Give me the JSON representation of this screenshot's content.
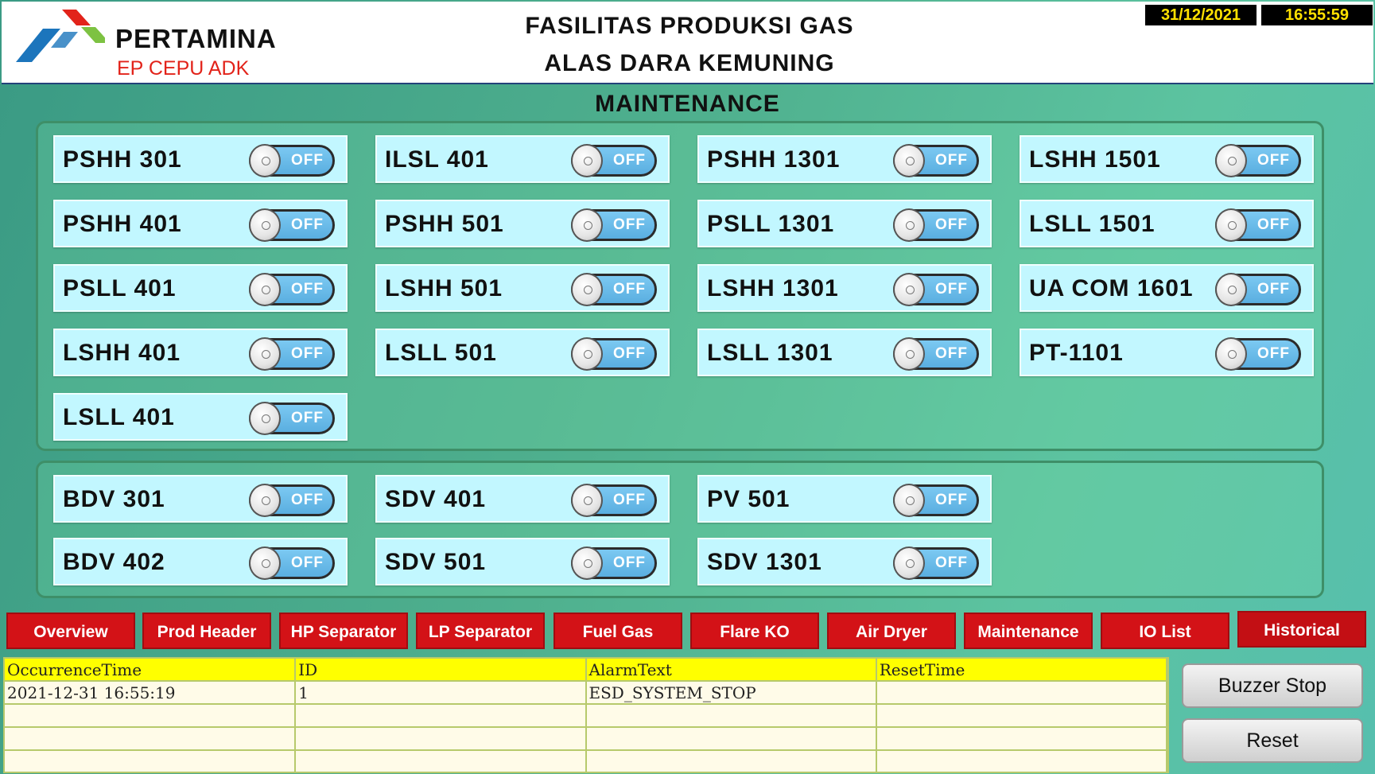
{
  "header": {
    "brand": "PERTAMINA",
    "brand_sub": "EP CEPU ADK",
    "title_line1": "FASILITAS PRODUKSI GAS",
    "title_line2": "ALAS DARA KEMUNING",
    "date": "31/12/2021",
    "time": "16:55:59"
  },
  "section_title": "MAINTENANCE",
  "colors": {
    "nav_red": "#d31217",
    "tile": "#c2f7ff",
    "switch_blue": "#6ab9e8",
    "clock_text": "#ffe100"
  },
  "group1": [
    {
      "label": "PSHH 301",
      "state": "OFF"
    },
    {
      "label": "ILSL 401",
      "state": "OFF"
    },
    {
      "label": "PSHH 1301",
      "state": "OFF"
    },
    {
      "label": "LSHH 1501",
      "state": "OFF"
    },
    {
      "label": "PSHH 401",
      "state": "OFF"
    },
    {
      "label": "PSHH 501",
      "state": "OFF"
    },
    {
      "label": "PSLL 1301",
      "state": "OFF"
    },
    {
      "label": "LSLL 1501",
      "state": "OFF"
    },
    {
      "label": "PSLL 401",
      "state": "OFF"
    },
    {
      "label": "LSHH 501",
      "state": "OFF"
    },
    {
      "label": "LSHH 1301",
      "state": "OFF"
    },
    {
      "label": "UA COM 1601",
      "state": "OFF"
    },
    {
      "label": "LSHH 401",
      "state": "OFF"
    },
    {
      "label": "LSLL 501",
      "state": "OFF"
    },
    {
      "label": "LSLL 1301",
      "state": "OFF"
    },
    {
      "label": "PT-1101",
      "state": "OFF"
    },
    {
      "label": "LSLL 401",
      "state": "OFF"
    }
  ],
  "group2": [
    {
      "label": "BDV 301",
      "state": "OFF"
    },
    {
      "label": "SDV 401",
      "state": "OFF"
    },
    {
      "label": "PV 501",
      "state": "OFF"
    },
    {
      "label": "BDV 402",
      "state": "OFF"
    },
    {
      "label": "SDV 501",
      "state": "OFF"
    },
    {
      "label": "SDV 1301",
      "state": "OFF"
    }
  ],
  "nav": [
    "Overview",
    "Prod Header",
    "HP Separator",
    "LP Separator",
    "Fuel Gas",
    "Flare KO",
    "Air Dryer",
    "Maintenance",
    "IO List",
    "Historical"
  ],
  "alarm": {
    "columns": [
      "OccurrenceTime",
      "ID",
      "AlarmText",
      "ResetTime"
    ],
    "rows": [
      [
        "2021-12-31  16:55:19",
        "1",
        "ESD_SYSTEM_STOP",
        ""
      ],
      [
        "",
        "",
        "",
        ""
      ],
      [
        "",
        "",
        "",
        ""
      ],
      [
        "",
        "",
        "",
        ""
      ]
    ]
  },
  "buttons": {
    "buzzer_stop": "Buzzer Stop",
    "reset": "Reset"
  },
  "icons": {
    "logo": "pertamina-logo-icon"
  }
}
